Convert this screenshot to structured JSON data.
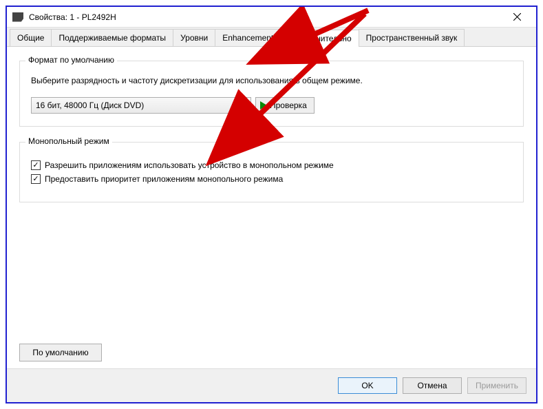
{
  "title": "Свойства: 1 - PL2492H",
  "tabs": {
    "general": "Общие",
    "formats": "Поддерживаемые форматы",
    "levels": "Уровни",
    "enhancements": "Enhancements",
    "advanced": "Дополнительно",
    "spatial": "Пространственный звук"
  },
  "defaultFormat": {
    "legend": "Формат по умолчанию",
    "help": "Выберите разрядность и частоту дискретизации для использования в общем режиме.",
    "selected": "16 бит, 48000 Гц (Диск DVD)",
    "testLabel": "Проверка"
  },
  "exclusive": {
    "legend": "Монопольный режим",
    "opt1": "Разрешить приложениям использовать устройство в монопольном режиме",
    "opt2": "Предоставить приоритет приложениям монопольного режима"
  },
  "buttons": {
    "restore": "По умолчанию",
    "ok": "OK",
    "cancel": "Отмена",
    "apply": "Применить"
  }
}
